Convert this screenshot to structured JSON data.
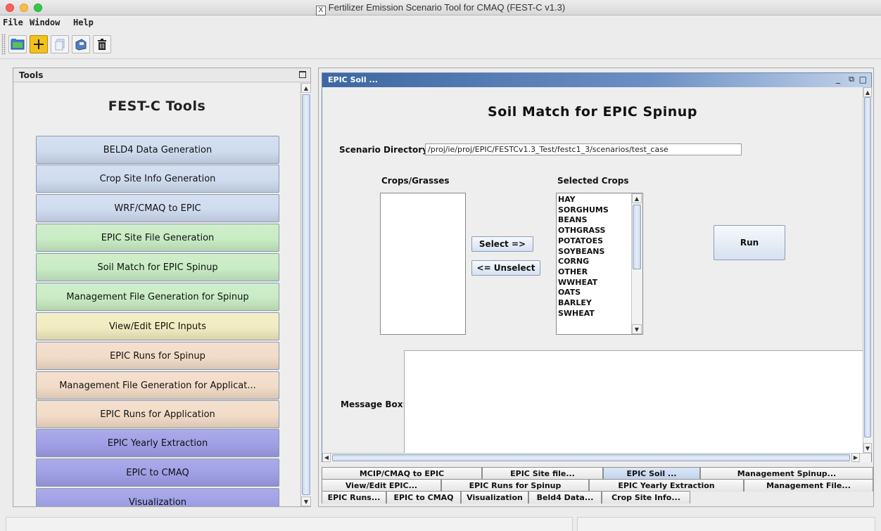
{
  "window": {
    "title": "Fertilizer Emission Scenario Tool for CMAQ (FEST-C v1.3)",
    "x_glyph": "X"
  },
  "menu": [
    {
      "label": "File"
    },
    {
      "label": "Window"
    },
    {
      "label": "Help"
    }
  ],
  "toolbar": {
    "icons": [
      "open-folder-icon",
      "add-icon",
      "copy-icon",
      "save-icon",
      "trash-icon"
    ]
  },
  "tools_frame": {
    "title": "Tools",
    "heading": "FEST-C Tools",
    "buttons": [
      {
        "label": "BELD4 Data Generation",
        "color": "#cfdcef"
      },
      {
        "label": "Crop Site Info Generation",
        "color": "#cfdcef"
      },
      {
        "label": "WRF/CMAQ to EPIC",
        "color": "#cfdcef"
      },
      {
        "label": "EPIC Site File Generation",
        "color": "#c8ecc4"
      },
      {
        "label": "Soil Match for EPIC Spinup",
        "color": "#c8ecc4"
      },
      {
        "label": "Management File Generation for Spinup",
        "color": "#c8ecc4"
      },
      {
        "label": "View/Edit EPIC Inputs",
        "color": "#f2ecc0"
      },
      {
        "label": "EPIC Runs for Spinup",
        "color": "#f2dcc8"
      },
      {
        "label": "Management File Generation for Applicat...",
        "color": "#f2dcc8"
      },
      {
        "label": "EPIC Runs for Application",
        "color": "#f2dcc8"
      },
      {
        "label": "EPIC Yearly Extraction",
        "color": "#9f9fe6"
      },
      {
        "label": "EPIC to CMAQ",
        "color": "#9f9fe6"
      },
      {
        "label": "Visualization",
        "color": "#9f9fe6"
      }
    ]
  },
  "epic_soil": {
    "frame_title": "EPIC Soil ...",
    "heading": "Soil Match for EPIC Spinup",
    "scenario_label": "Scenario Directory:",
    "scenario_value": "/proj/ie/proj/EPIC/FESTCv1.3_Test/festc1_3/scenarios/test_case",
    "crops_label": "Crops/Grasses",
    "selected_label": "Selected Crops",
    "selected_crops": [
      "HAY",
      "SORGHUMS",
      "BEANS",
      "OTHGRASS",
      "POTATOES",
      "SOYBEANS",
      "CORNG",
      "OTHER",
      "WWHEAT",
      "OATS",
      "BARLEY",
      "SWHEAT"
    ],
    "select_button": "Select =>",
    "unselect_button": "<= Unselect",
    "run_button": "Run",
    "message_label": "Message Box:"
  },
  "tabs": {
    "row1": [
      "MCIP/CMAQ to EPIC",
      "EPIC Site file...",
      "EPIC Soil ...",
      "Management Spinup..."
    ],
    "row2": [
      "View/Edit EPIC...",
      "EPIC Runs for Spinup",
      "EPIC Yearly Extraction",
      "Management File..."
    ],
    "row3": [
      "EPIC Runs...",
      "EPIC to CMAQ",
      "Visualization",
      "Beld4 Data...",
      "Crop Site Info..."
    ],
    "active": "EPIC Soil ..."
  },
  "colors": {
    "accent_title": "#3d67a2",
    "active_tab": "#c0d2ec"
  }
}
